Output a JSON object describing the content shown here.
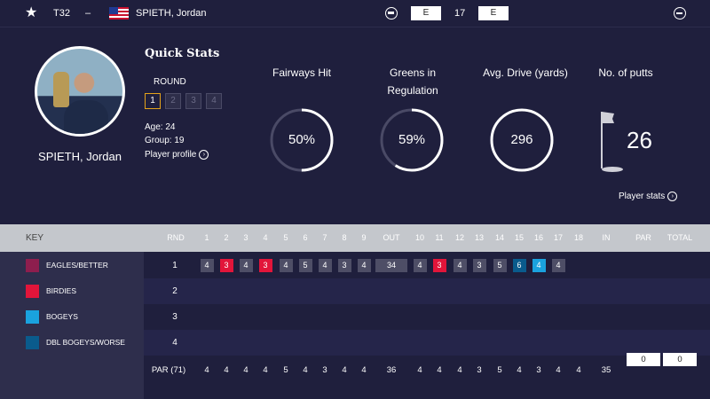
{
  "topbar": {
    "star_icon": "star-icon",
    "position": "T32",
    "dash": "–",
    "flag": "us-flag",
    "player_name": "SPIETH, Jordan",
    "score1": "E",
    "thru": "17",
    "score2": "E"
  },
  "profile": {
    "name": "SPIETH, Jordan",
    "quick_stats_title": "Quick Stats",
    "round_label": "ROUND",
    "rounds": [
      "1",
      "2",
      "3",
      "4"
    ],
    "active_round": 0,
    "age": "Age: 24",
    "group": "Group: 19",
    "player_profile": "Player profile"
  },
  "stats": {
    "fairways_title": "Fairways Hit",
    "fairways_value": "50%",
    "fairways_pct": 0.5,
    "greens_title_1": "Greens in",
    "greens_title_2": "Regulation",
    "greens_value": "59%",
    "greens_pct": 0.59,
    "drive_title": "Avg. Drive (yards)",
    "drive_value": "296",
    "drive_pct": 1.0,
    "putts_title": "No. of putts",
    "putts_value": "26",
    "player_stats": "Player stats"
  },
  "key": {
    "title": "KEY",
    "items": [
      {
        "label": "EAGLES/BETTER",
        "color": "#8e1e4e"
      },
      {
        "label": "BIRDIES",
        "color": "#e2153a"
      },
      {
        "label": "BOGEYS",
        "color": "#1aa2de"
      },
      {
        "label": "DBL BOGEYS/WORSE",
        "color": "#0a5b8c"
      }
    ]
  },
  "scorecard": {
    "headers": [
      "RND",
      "1",
      "2",
      "3",
      "4",
      "5",
      "6",
      "7",
      "8",
      "9",
      "OUT",
      "10",
      "11",
      "12",
      "13",
      "14",
      "15",
      "16",
      "17",
      "18",
      "IN",
      "PAR",
      "TOTAL"
    ],
    "rounds": [
      {
        "round": "1",
        "scores": [
          "4",
          "3",
          "4",
          "3",
          "4",
          "5",
          "4",
          "3",
          "4",
          "34",
          "4",
          "3",
          "4",
          "3",
          "5",
          "6",
          "4",
          "4",
          "",
          "",
          "",
          ""
        ],
        "types": [
          "",
          "birdie",
          "",
          "birdie",
          "",
          "",
          "",
          "",
          "",
          "out",
          "",
          "birdie",
          "",
          "",
          "",
          "dbl",
          "bogey",
          "",
          "",
          "",
          "",
          ""
        ]
      },
      {
        "round": "2",
        "scores": [],
        "types": []
      },
      {
        "round": "3",
        "scores": [],
        "types": []
      },
      {
        "round": "4",
        "scores": [],
        "types": []
      }
    ],
    "par_label": "PAR (71)",
    "par": [
      "4",
      "4",
      "4",
      "4",
      "5",
      "4",
      "3",
      "4",
      "4",
      "36",
      "4",
      "4",
      "4",
      "3",
      "5",
      "4",
      "3",
      "4",
      "4",
      "35"
    ],
    "par_total": "0",
    "total": "0"
  }
}
